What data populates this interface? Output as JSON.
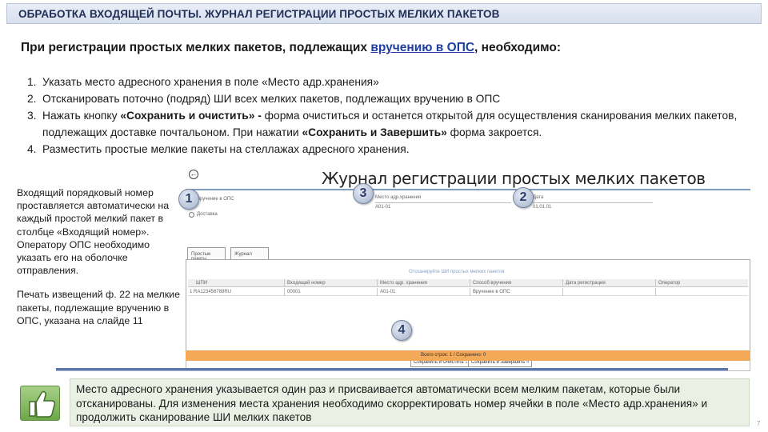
{
  "header": {
    "title": "ОБРАБОТКА ВХОДЯЩЕЙ ПОЧТЫ. ЖУРНАЛ РЕГИСТРАЦИИ ПРОСТЫХ МЕЛКИХ ПАКЕТОВ"
  },
  "intro": {
    "before": "При регистрации простых мелких пакетов, подлежащих ",
    "underlined": "вручению в ОПС",
    "after": ", необходимо:"
  },
  "steps": [
    {
      "num": "1.",
      "text": "Указать место адресного хранения в поле «Место адр.хранения»"
    },
    {
      "num": "2.",
      "text": "Отсканировать поточно (подряд) ШИ всех мелких пакетов, подлежащих вручению в ОПС"
    },
    {
      "num": "3.",
      "part1": "Нажать кнопку ",
      "bold1": "«Сохранить и очистить» -",
      "part2": " форма очиститься и останется открытой для осуществления сканирования мелких пакетов, подлежащих доставке почтальоном. При нажатии ",
      "bold2": "«Сохранить и Завершить»",
      "part3": " форма закроется."
    },
    {
      "num": "4.",
      "text": "Разместить простые мелкие пакеты на стеллажах адресного хранения."
    }
  ],
  "left_note": {
    "p1": "Входящий порядковый номер проставляется автоматически на каждый простой мелкий пакет в столбце «Входящий номер». Оператору ОПС необходимо указать его на оболочке отправления.",
    "p2": "Печать извещений  ф. 22 на мелкие пакеты, подлежащие вручению в ОПС, указана на слайде 11"
  },
  "form": {
    "title": "Журнал регистрации простых мелких пакетов",
    "back_icon": "back-arrow-icon",
    "radio1": "Вручение в ОПС",
    "radio2": "Доставка",
    "field_storage": "Место адр.хранения",
    "field_date": "Дата",
    "storage_value": "A01-01",
    "date_value": "01.01.01",
    "tab1": "Простые пакеты",
    "tab2": "Журнал",
    "pane_hint": "Отсканируйте ШИ простых мелких пакетов",
    "columns": [
      "ШПИ",
      "Входящий номер",
      "Место адр. хранения",
      "Способ вручения",
      "Дата регистрации",
      "Оператор"
    ],
    "row": [
      "1  RA123456789RU",
      "00001",
      "A01-01",
      "Вручение в ОПС",
      "",
      ""
    ],
    "btn_save_clear": "Сохранить и Очистить",
    "btn_save_finish": "Сохранить и Завершить",
    "btn_save_clear_num": "1",
    "btn_save_finish_num": "4",
    "status": "Всего строк: 1 / Сохранено: 0"
  },
  "markers": [
    "1",
    "3",
    "2",
    "4"
  ],
  "note": "Место адресного хранения указывается один раз и присваивается автоматически всем мелким пакетам, которые были отсканированы. Для изменения места хранения необходимо скорректировать номер ячейки в поле «Место адр.хранения» и продолжить сканирование ШИ мелких пакетов",
  "note_icon": "thumbs-up-icon",
  "page_number": "7",
  "colors": {
    "header_text": "#1f2f55",
    "accent": "#5d76a8",
    "note_bg": "#eaf1e4",
    "status_strip": "#f4a958"
  }
}
